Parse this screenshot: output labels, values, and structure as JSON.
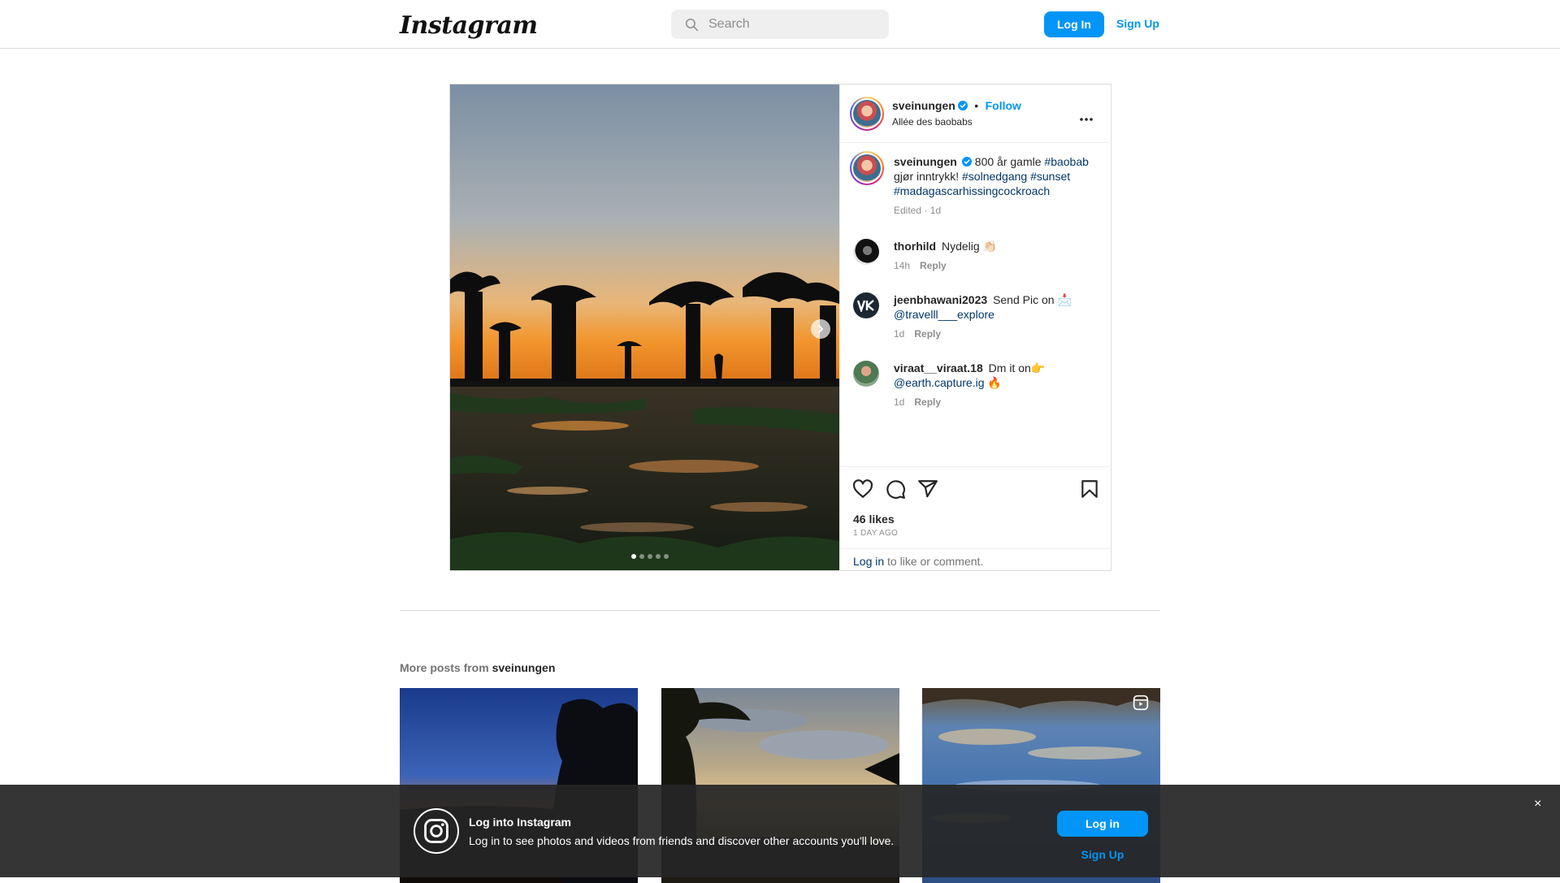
{
  "nav": {
    "logo_text": "Instagram",
    "search_placeholder": "Search",
    "login_label": "Log In",
    "signup_label": "Sign Up"
  },
  "post": {
    "author": "sveinungen",
    "follow_label": "Follow",
    "separator": "•",
    "location": "Allée des baobabs",
    "more_icon": "more-horizontal-icon",
    "carousel": {
      "slide_count": 5,
      "active_slide": 1
    },
    "caption": {
      "user": "sveinungen",
      "text": "800 år gamle",
      "tag1": "#baobab",
      "text2": "gjør inntrykk!",
      "tag2": "#solnedgang",
      "tag3": "#sunset",
      "tag4": "#madagascarhissingcockroach",
      "meta": "Edited · 1d"
    },
    "comments": [
      {
        "user": "thorhild",
        "text": "Nydelig 👏🏻",
        "mention": "",
        "suffix": "",
        "time": "14h",
        "reply": "Reply"
      },
      {
        "user": "jeenbhawani2023",
        "text": "Send Pic on 📩",
        "mention": "@travelll___explore",
        "suffix": "",
        "time": "1d",
        "reply": "Reply"
      },
      {
        "user": "viraat__viraat.18",
        "text": "Dm it on👉",
        "mention": "@earth.capture.ig",
        "suffix": "🔥",
        "time": "1d",
        "reply": "Reply"
      }
    ],
    "likes": "46 likes",
    "date": "1 DAY AGO",
    "login_link": "Log in",
    "login_rest": " to like or comment."
  },
  "more_posts": {
    "prefix": "More posts from ",
    "user": "sveinungen"
  },
  "banner": {
    "title": "Log into Instagram",
    "text": "Log in to see photos and videos from friends and discover other accounts you'll love.",
    "login_label": "Log in",
    "signup_label": "Sign Up",
    "close_label": "×"
  },
  "colors": {
    "accent": "#0095f6",
    "link": "#00376b",
    "border": "#dbdbdb"
  }
}
